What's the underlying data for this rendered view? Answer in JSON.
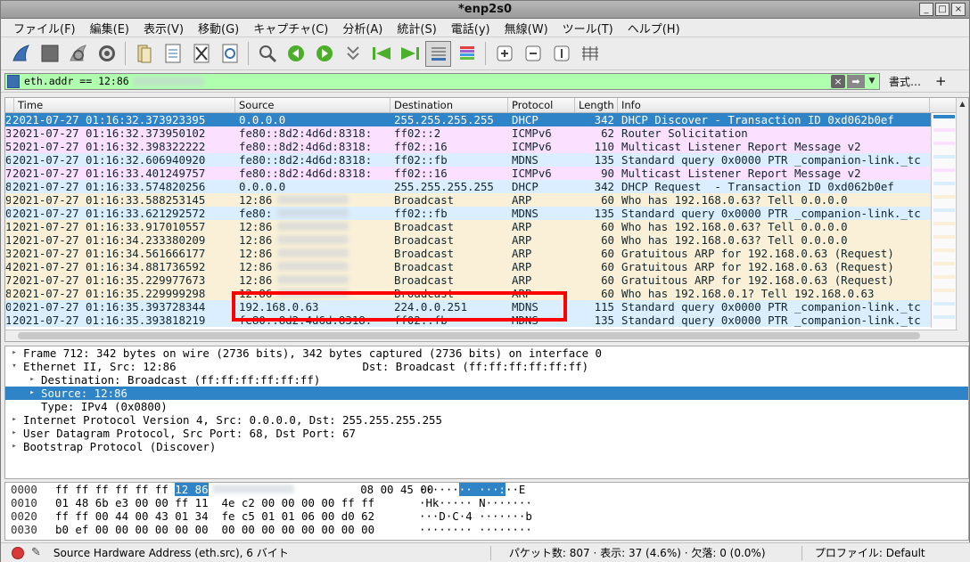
{
  "window": {
    "title": "*enp2s0",
    "controls": [
      "_",
      "□",
      "×"
    ]
  },
  "menu": [
    "ファイル(F)",
    "編集(E)",
    "表示(V)",
    "移動(G)",
    "キャプチャ(C)",
    "分析(A)",
    "統計(S)",
    "電話(y)",
    "無線(W)",
    "ツール(T)",
    "ヘルプ(H)"
  ],
  "toolbar": {
    "icons": [
      "shark-fin-icon",
      "stop-icon",
      "restart-icon",
      "options-gear-icon",
      "open-file-icon",
      "save-file-icon",
      "close-file-icon",
      "reload-icon",
      "find-icon",
      "go-back-icon",
      "go-forward-icon",
      "go-to-packet-icon",
      "first-packet-icon",
      "last-packet-icon",
      "autoscroll-icon",
      "colorize-icon",
      "zoom-in-icon",
      "zoom-out-icon",
      "normal-size-icon",
      "resize-columns-icon"
    ]
  },
  "filter": {
    "text": "eth.addr == 12:86",
    "expression_label": "書式…",
    "plus_label": "+",
    "clear_glyph": "×",
    "apply_glyph": "➡",
    "dropdown_glyph": "▼",
    "bg_color": "#afffaf"
  },
  "packet_list": {
    "columns": [
      "Time",
      "Source",
      "Destination",
      "Protocol",
      "Length",
      "Info"
    ],
    "rows": [
      {
        "no": "2",
        "time": "2021-07-27 01:16:32.373923395",
        "src": "0.0.0.0",
        "dst": "255.255.255.255",
        "proto": "DHCP",
        "len": "342",
        "info": "DHCP Discover - Transaction ID 0xd062b0ef",
        "bg": "#2f83c7",
        "fg": "#ffffff"
      },
      {
        "no": "3",
        "time": "2021-07-27 01:16:32.373950102",
        "src": "fe80::8d2:4d6d:8318:",
        "dst": "ff02::2",
        "proto": "ICMPv6",
        "len": "62",
        "info": "Router Solicitation",
        "bg": "#fce0ff",
        "fg": "#12272e"
      },
      {
        "no": "5",
        "time": "2021-07-27 01:16:32.398322222",
        "src": "fe80::8d2:4d6d:8318:",
        "dst": "ff02::16",
        "proto": "ICMPv6",
        "len": "110",
        "info": "Multicast Listener Report Message v2",
        "bg": "#fce0ff",
        "fg": "#12272e"
      },
      {
        "no": "6",
        "time": "2021-07-27 01:16:32.606940920",
        "src": "fe80::8d2:4d6d:8318:",
        "dst": "ff02::fb",
        "proto": "MDNS",
        "len": "135",
        "info": "Standard query 0x0000 PTR _companion-link._tc",
        "bg": "#daeeff",
        "fg": "#12272e"
      },
      {
        "no": "7",
        "time": "2021-07-27 01:16:33.401249757",
        "src": "fe80::8d2:4d6d:8318:",
        "dst": "ff02::16",
        "proto": "ICMPv6",
        "len": "90",
        "info": "Multicast Listener Report Message v2",
        "bg": "#fce0ff",
        "fg": "#12272e"
      },
      {
        "no": "8",
        "time": "2021-07-27 01:16:33.574820256",
        "src": "0.0.0.0",
        "dst": "255.255.255.255",
        "proto": "DHCP",
        "len": "342",
        "info": "DHCP Request  - Transaction ID 0xd062b0ef",
        "bg": "#daeeff",
        "fg": "#12272e"
      },
      {
        "no": "9",
        "time": "2021-07-27 01:16:33.588253145",
        "src": "12:86",
        "dst": "Broadcast",
        "proto": "ARP",
        "len": "60",
        "info": "Who has 192.168.0.63? Tell 0.0.0.0",
        "bg": "#faf0d7",
        "fg": "#12272e",
        "src_blur": true
      },
      {
        "no": "0",
        "time": "2021-07-27 01:16:33.621292572",
        "src": "fe80:",
        "dst": "ff02::fb",
        "proto": "MDNS",
        "len": "135",
        "info": "Standard query 0x0000 PTR _companion-link._tc",
        "bg": "#daeeff",
        "fg": "#12272e",
        "src_blur": true
      },
      {
        "no": "1",
        "time": "2021-07-27 01:16:33.917010557",
        "src": "12:86",
        "dst": "Broadcast",
        "proto": "ARP",
        "len": "60",
        "info": "Who has 192.168.0.63? Tell 0.0.0.0",
        "bg": "#faf0d7",
        "fg": "#12272e",
        "src_blur": true
      },
      {
        "no": "1",
        "time": "2021-07-27 01:16:34.233380209",
        "src": "12:86",
        "dst": "Broadcast",
        "proto": "ARP",
        "len": "60",
        "info": "Who has 192.168.0.63? Tell 0.0.0.0",
        "bg": "#faf0d7",
        "fg": "#12272e",
        "src_blur": true
      },
      {
        "no": "3",
        "time": "2021-07-27 01:16:34.561666177",
        "src": "12:86",
        "dst": "Broadcast",
        "proto": "ARP",
        "len": "60",
        "info": "Gratuitous ARP for 192.168.0.63 (Request)",
        "bg": "#faf0d7",
        "fg": "#12272e",
        "src_blur": true
      },
      {
        "no": "4",
        "time": "2021-07-27 01:16:34.881736592",
        "src": "12:86",
        "dst": "Broadcast",
        "proto": "ARP",
        "len": "60",
        "info": "Gratuitous ARP for 192.168.0.63 (Request)",
        "bg": "#faf0d7",
        "fg": "#12272e",
        "src_blur": true
      },
      {
        "no": "7",
        "time": "2021-07-27 01:16:35.229977673",
        "src": "12:86",
        "dst": "Broadcast",
        "proto": "ARP",
        "len": "60",
        "info": "Gratuitous ARP for 192.168.0.63 (Request)",
        "bg": "#faf0d7",
        "fg": "#12272e",
        "src_blur": true
      },
      {
        "no": "8",
        "time": "2021-07-27 01:16:35.229999298",
        "src": "12:86",
        "dst": "Broadcast",
        "proto": "ARP",
        "len": "60",
        "info": "Who has 192.168.0.1? Tell 192.168.0.63",
        "bg": "#faf0d7",
        "fg": "#12272e",
        "src_blur": true
      },
      {
        "no": "0",
        "time": "2021-07-27 01:16:35.393728344",
        "src": "192.168.0.63",
        "dst": "224.0.0.251",
        "proto": "MDNS",
        "len": "115",
        "info": "Standard query 0x0000 PTR _companion-link._tc",
        "bg": "#daeeff",
        "fg": "#12272e"
      },
      {
        "no": "1",
        "time": "2021-07-27 01:16:35.393818219",
        "src": "fe80::8d2:4d6d:8318:",
        "dst": "ff02::fb",
        "proto": "MDNS",
        "len": "135",
        "info": "Standard query 0x0000 PTR _companion-link._tc",
        "bg": "#daeeff",
        "fg": "#12272e"
      }
    ],
    "highlight_color": "#ff0000"
  },
  "details": [
    {
      "tri": "▸",
      "text": "Frame 712: 342 bytes on wire (2736 bits), 342 bytes captured (2736 bits) on interface 0",
      "level": 0,
      "sel": false
    },
    {
      "tri": "▾",
      "text": "Ethernet II, Src: 12:86                            Dst: Broadcast (ff:ff:ff:ff:ff:ff)",
      "level": 0,
      "sel": false
    },
    {
      "tri": "▸",
      "text": "Destination: Broadcast (ff:ff:ff:ff:ff:ff)",
      "level": 1,
      "sel": false
    },
    {
      "tri": "▸",
      "text": "Source: 12:86",
      "level": 1,
      "sel": true
    },
    {
      "tri": "",
      "text": "Type: IPv4 (0x0800)",
      "level": 1,
      "sel": false
    },
    {
      "tri": "▸",
      "text": "Internet Protocol Version 4, Src: 0.0.0.0, Dst: 255.255.255.255",
      "level": 0,
      "sel": false
    },
    {
      "tri": "▸",
      "text": "User Datagram Protocol, Src Port: 68, Dst Port: 67",
      "level": 0,
      "sel": false
    },
    {
      "tri": "▸",
      "text": "Bootstrap Protocol (Discover)",
      "level": 0,
      "sel": false
    }
  ],
  "bytes": [
    {
      "off": "0000",
      "hex_pre": "ff ff ff ff ff ff ",
      "hex_hl": "12 86",
      "hex_post": "          08 00 45 00",
      "asc_pre": "······",
      "asc_hl": "·· ···:",
      "asc_post": "··E"
    },
    {
      "off": "0010",
      "hex_pre": "01 48 6b e3 00 00 ff 11  4e c2 00 00 00 00 ff ff",
      "hex_hl": "",
      "hex_post": "",
      "asc_pre": "·Hk····· N·······",
      "asc_hl": "",
      "asc_post": ""
    },
    {
      "off": "0020",
      "hex_pre": "ff ff 00 44 00 43 01 34  fe c5 01 01 06 00 d0 62",
      "hex_hl": "",
      "hex_post": "",
      "asc_pre": "···D·C·4 ·······b",
      "asc_hl": "",
      "asc_post": ""
    },
    {
      "off": "0030",
      "hex_pre": "b0 ef 00 00 00 00 00 00  00 00 00 00 00 00 00 00",
      "hex_hl": "",
      "hex_post": "",
      "asc_pre": "········ ········",
      "asc_hl": "",
      "asc_post": ""
    }
  ],
  "status": {
    "field": "Source Hardware Address (eth.src), 6 バイト",
    "packets": "パケット数: 807 · 表示: 37 (4.6%) · 欠落: 0 (0.0%)",
    "profile": "プロファイル: Default"
  }
}
